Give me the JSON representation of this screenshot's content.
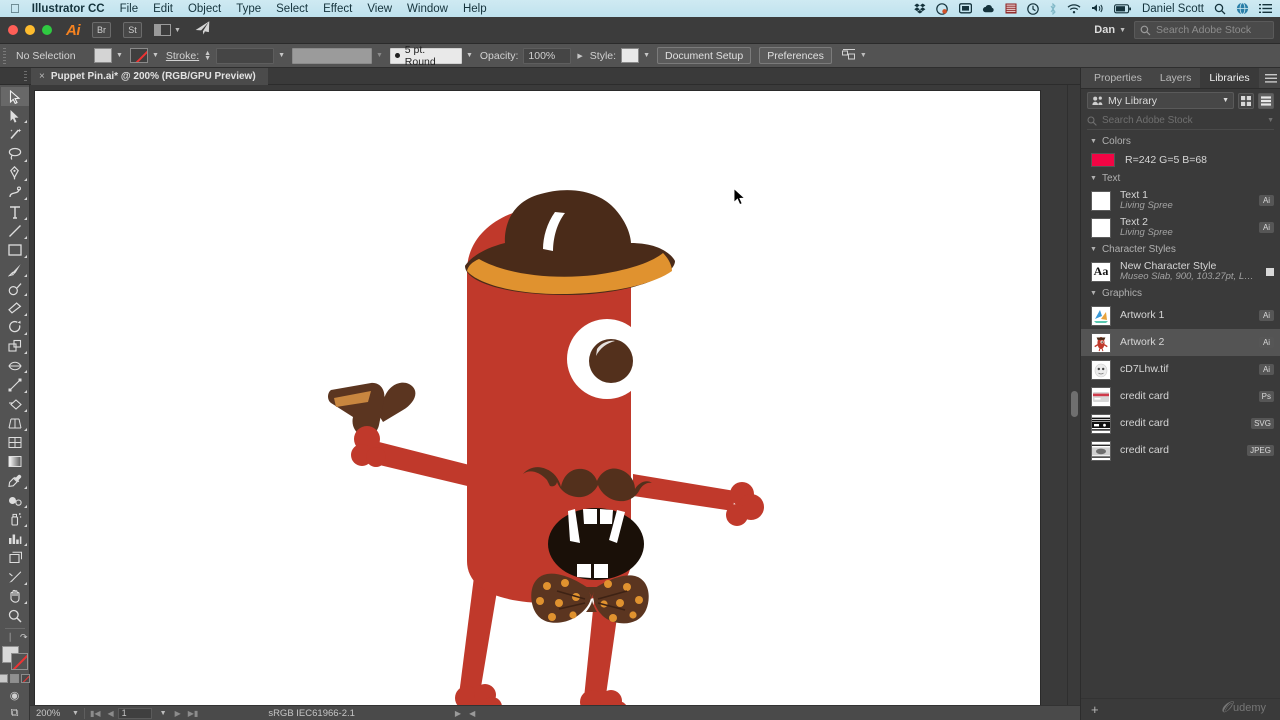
{
  "macmenu": {
    "apple": "apple-logo",
    "app_name": "Illustrator CC",
    "items": [
      "File",
      "Edit",
      "Object",
      "Type",
      "Select",
      "Effect",
      "View",
      "Window",
      "Help"
    ],
    "status_icons": [
      "dropbox-icon",
      "colorpicker-icon",
      "display-icon",
      "cloud-icon",
      "graph-icon",
      "timemachine-icon",
      "bluetooth-icon",
      "wifi-icon",
      "volume-icon",
      "battery-icon"
    ],
    "user": "Daniel Scott",
    "right_icons": [
      "search-icon",
      "globe-icon",
      "notification-center-icon"
    ]
  },
  "appbar": {
    "logo": "Ai",
    "bridge_label": "Br",
    "stock_label": "St",
    "arrange_label": "arrange-documents",
    "share_label": "share-icon",
    "user_short": "Dan",
    "stock_search_placeholder": "Search Adobe Stock"
  },
  "control": {
    "selection_state": "No Selection",
    "fill_label": "fill-swatch",
    "stroke_swatch_label": "stroke-swatch",
    "stroke_label": "Stroke:",
    "stroke_weight": "",
    "stroke_profile": "",
    "brush_definition": "5 pt. Round",
    "opacity_label": "Opacity:",
    "opacity_value": "100%",
    "style_label": "Style:",
    "document_setup": "Document Setup",
    "preferences": "Preferences",
    "align_label": "align-icon"
  },
  "tabbar": {
    "close_glyph": "×",
    "document_title": "Puppet Pin.ai* @ 200% (RGB/GPU Preview)"
  },
  "toolbar": {
    "tools": [
      {
        "name": "selection-tool",
        "selected": true
      },
      {
        "name": "direct-selection-tool",
        "selected": false
      },
      {
        "name": "magic-wand-tool",
        "selected": false
      },
      {
        "name": "lasso-tool",
        "selected": false
      },
      {
        "name": "pen-tool",
        "selected": false
      },
      {
        "name": "curvature-tool",
        "selected": false
      },
      {
        "name": "type-tool",
        "selected": false
      },
      {
        "name": "line-segment-tool",
        "selected": false
      },
      {
        "name": "rectangle-tool",
        "selected": false
      },
      {
        "name": "paintbrush-tool",
        "selected": false
      },
      {
        "name": "shaper-tool",
        "selected": false
      },
      {
        "name": "eraser-tool",
        "selected": false
      },
      {
        "name": "rotate-tool",
        "selected": false
      },
      {
        "name": "scale-tool",
        "selected": false
      },
      {
        "name": "width-tool",
        "selected": false
      },
      {
        "name": "free-transform-tool",
        "selected": false
      },
      {
        "name": "shape-builder-tool",
        "selected": false
      },
      {
        "name": "perspective-grid-tool",
        "selected": false
      },
      {
        "name": "mesh-tool",
        "selected": false
      },
      {
        "name": "gradient-tool",
        "selected": false
      },
      {
        "name": "eyedropper-tool",
        "selected": false
      },
      {
        "name": "blend-tool",
        "selected": false
      },
      {
        "name": "symbol-sprayer-tool",
        "selected": false
      },
      {
        "name": "column-graph-tool",
        "selected": false
      },
      {
        "name": "artboard-tool",
        "selected": false
      },
      {
        "name": "slice-tool",
        "selected": false
      },
      {
        "name": "hand-tool",
        "selected": false
      },
      {
        "name": "zoom-tool",
        "selected": false
      }
    ],
    "fill_color": "#d9d9d9",
    "stroke_color": "none"
  },
  "canvas": {
    "artwork_name": "monster-character-artwork",
    "colors": {
      "body_red": "#c0392b",
      "body_red_dark": "#b23a2c",
      "hat_brown": "#4a2b19",
      "hat_band_orange": "#e0922f",
      "eye_white": "#ffffff",
      "pupil_brown": "#53301c",
      "mouth_black": "#1a1008",
      "tooth_white": "#ffffff",
      "bowtie_brown": "#5b3520",
      "bowtie_dot": "#e0922f",
      "background": "#ffffff"
    },
    "cursor": "arrow-cursor"
  },
  "statusbar": {
    "zoom": "200%",
    "page": "1",
    "color_profile": "sRGB IEC61966-2.1"
  },
  "rightpanel": {
    "tabs": [
      {
        "label": "Properties",
        "active": false
      },
      {
        "label": "Layers",
        "active": false
      },
      {
        "label": "Libraries",
        "active": true
      }
    ],
    "menu_icon": "panel-menu-icon",
    "library_select": "My Library",
    "view_grid_icon": "grid-view-icon",
    "view_list_icon": "list-view-icon",
    "search_placeholder": "Search Adobe Stock",
    "groups": [
      {
        "title": "Colors",
        "type": "colors",
        "items": [
          {
            "name": "R=242 G=5 B=68",
            "color": "#f20544"
          }
        ]
      },
      {
        "title": "Text",
        "type": "assets",
        "items": [
          {
            "name": "Text 1",
            "sub": "Living Spree",
            "badge": "Ai",
            "thumb": "#ffffff"
          },
          {
            "name": "Text 2",
            "sub": "Living Spree",
            "badge": "Ai",
            "thumb": "#ffffff"
          }
        ]
      },
      {
        "title": "Character Styles",
        "type": "charstyles",
        "items": [
          {
            "name": "New Character Style",
            "sub": "Museo Slab, 900, 103.27pt, Leadin...",
            "thumb_text": "Aa"
          }
        ]
      },
      {
        "title": "Graphics",
        "type": "assets",
        "items": [
          {
            "name": "Artwork 1",
            "badge": "Ai",
            "thumb_kind": "artwork1",
            "selected": false
          },
          {
            "name": "Artwork 2",
            "badge": "Ai",
            "thumb_kind": "artwork2",
            "selected": true
          },
          {
            "name": "cD7Lhw.tif",
            "badge": "Ai",
            "thumb_kind": "ghost",
            "selected": false
          },
          {
            "name": "credit card",
            "badge": "Ps",
            "thumb_kind": "card-red",
            "selected": false
          },
          {
            "name": "credit card",
            "badge": "SVG",
            "thumb_kind": "card-black",
            "selected": false
          },
          {
            "name": "credit card",
            "badge": "JPEG",
            "thumb_kind": "card-grey",
            "selected": false
          }
        ]
      }
    ],
    "add_button": "+",
    "watermark": "udemy"
  }
}
